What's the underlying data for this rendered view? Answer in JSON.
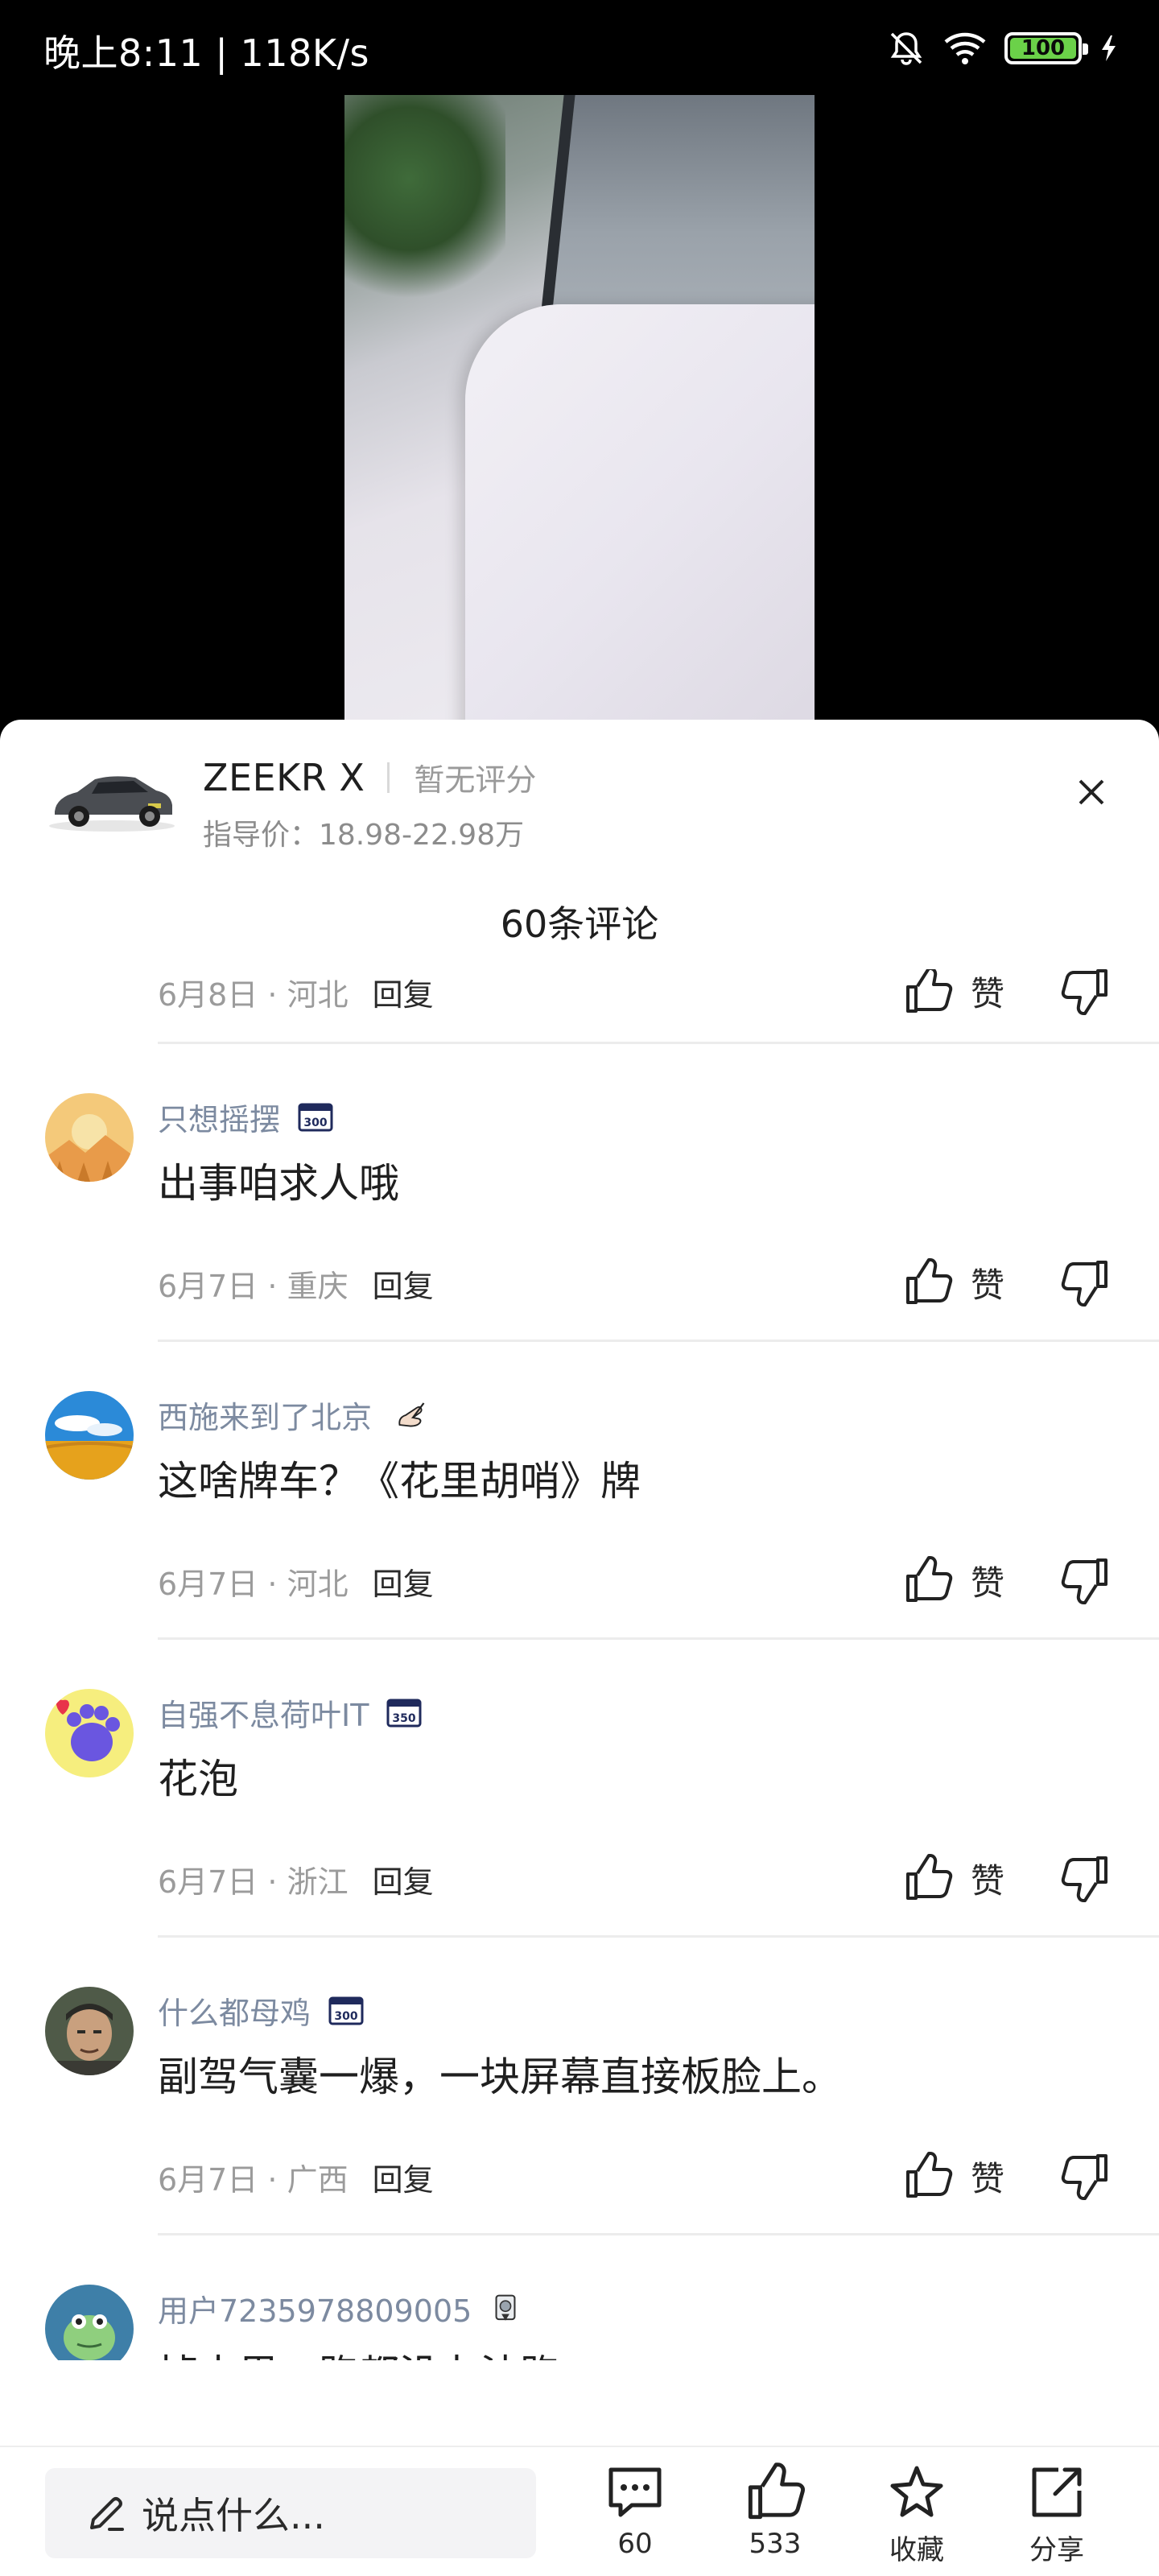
{
  "status_bar": {
    "time": "晚上8:11 | 118K/s",
    "battery": "100",
    "battery_color": "#6bd149"
  },
  "car": {
    "name": "ZEEKR X",
    "rating": "暂无评分",
    "price": "指导价：18.98-22.98万"
  },
  "comments_header": {
    "count_label": "60条评论"
  },
  "like_label": "赞",
  "partial_comment": {
    "date_location": "6月8日 · 河北",
    "reply": "回复"
  },
  "comments": [
    {
      "username": "只想摇摆",
      "badge": "300",
      "text": "出事咱求人哦",
      "date_location": "6月7日 · 重庆",
      "reply": "回复",
      "avatar": "sunset-avatar"
    },
    {
      "username": "西施来到了北京",
      "badge": "hand",
      "text": "这啥牌车？《花里胡哨》牌",
      "date_location": "6月7日 · 河北",
      "reply": "回复",
      "avatar": "wheat-field-avatar"
    },
    {
      "username": "自强不息荷叶IT",
      "badge": "350",
      "text": "花泡",
      "date_location": "6月7日 · 浙江",
      "reply": "回复",
      "avatar": "paw-avatar"
    },
    {
      "username": "什么都母鸡",
      "badge": "300",
      "text": "副驾气囊一爆，一块屏幕直接板脸上。",
      "date_location": "6月7日 · 广西",
      "reply": "回复",
      "avatar": "man-avatar"
    },
    {
      "username": "用户7235978809005",
      "badge": "medal",
      "text": "掉水里，跑都没办法跑",
      "avatar": "frog-avatar"
    }
  ],
  "bottom_bar": {
    "input_placeholder": "说点什么...",
    "comments_count": "60",
    "likes_count": "533",
    "collect_label": "收藏",
    "share_label": "分享"
  }
}
